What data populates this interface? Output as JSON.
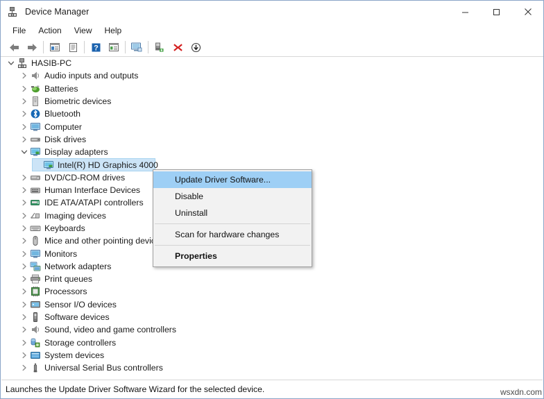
{
  "window": {
    "title": "Device Manager",
    "title_icon": "device-manager-icon",
    "minimize_label": "—",
    "maximize_label": "□",
    "close_label": "✕"
  },
  "menubar": {
    "items": [
      {
        "label": "File"
      },
      {
        "label": "Action"
      },
      {
        "label": "View"
      },
      {
        "label": "Help"
      }
    ]
  },
  "toolbar": {
    "buttons": [
      {
        "name": "back-icon",
        "title": "Back"
      },
      {
        "name": "forward-icon",
        "title": "Forward"
      },
      {
        "name": "separator-1",
        "title": ""
      },
      {
        "name": "properties-icon",
        "title": "Properties"
      },
      {
        "name": "show-hide-console-tree-icon",
        "title": "Show/Hide Console Tree"
      },
      {
        "name": "separator-2",
        "title": ""
      },
      {
        "name": "help-icon",
        "title": "Help"
      },
      {
        "name": "view-list-icon",
        "title": "View"
      },
      {
        "name": "separator-3",
        "title": ""
      },
      {
        "name": "scan-hardware-changes-icon",
        "title": "Scan for hardware changes"
      },
      {
        "name": "separator-4",
        "title": ""
      },
      {
        "name": "update-driver-icon",
        "title": "Update Driver Software"
      },
      {
        "name": "uninstall-device-icon",
        "title": "Uninstall"
      },
      {
        "name": "disable-device-icon",
        "title": "Disable"
      }
    ]
  },
  "tree": {
    "nodes": [
      {
        "label": "HASIB-PC",
        "level": 0,
        "twisty": "expanded",
        "icon": "computer-node-icon",
        "selected": false
      },
      {
        "label": "Audio inputs and outputs",
        "level": 1,
        "twisty": "collapsed",
        "icon": "speaker-icon",
        "selected": false
      },
      {
        "label": "Batteries",
        "level": 1,
        "twisty": "collapsed",
        "icon": "battery-icon",
        "selected": false
      },
      {
        "label": "Biometric devices",
        "level": 1,
        "twisty": "collapsed",
        "icon": "biometric-icon",
        "selected": false
      },
      {
        "label": "Bluetooth",
        "level": 1,
        "twisty": "collapsed",
        "icon": "bluetooth-icon",
        "selected": false
      },
      {
        "label": "Computer",
        "level": 1,
        "twisty": "collapsed",
        "icon": "monitor-icon",
        "selected": false
      },
      {
        "label": "Disk drives",
        "level": 1,
        "twisty": "collapsed",
        "icon": "disk-drive-icon",
        "selected": false
      },
      {
        "label": "Display adapters",
        "level": 1,
        "twisty": "expanded",
        "icon": "display-adapter-icon",
        "selected": false
      },
      {
        "label": "Intel(R) HD Graphics 4000",
        "level": 2,
        "twisty": "none",
        "icon": "display-adapter-icon",
        "selected": true
      },
      {
        "label": "DVD/CD-ROM drives",
        "level": 1,
        "twisty": "collapsed",
        "icon": "dvd-drive-icon",
        "selected": false
      },
      {
        "label": "Human Interface Devices",
        "level": 1,
        "twisty": "collapsed",
        "icon": "hid-icon",
        "selected": false
      },
      {
        "label": "IDE ATA/ATAPI controllers",
        "level": 1,
        "twisty": "collapsed",
        "icon": "ide-controller-icon",
        "selected": false
      },
      {
        "label": "Imaging devices",
        "level": 1,
        "twisty": "collapsed",
        "icon": "imaging-icon",
        "selected": false
      },
      {
        "label": "Keyboards",
        "level": 1,
        "twisty": "collapsed",
        "icon": "keyboard-icon",
        "selected": false
      },
      {
        "label": "Mice and other pointing devices",
        "level": 1,
        "twisty": "collapsed",
        "icon": "mouse-icon",
        "selected": false
      },
      {
        "label": "Monitors",
        "level": 1,
        "twisty": "collapsed",
        "icon": "monitor-icon",
        "selected": false
      },
      {
        "label": "Network adapters",
        "level": 1,
        "twisty": "collapsed",
        "icon": "network-adapter-icon",
        "selected": false
      },
      {
        "label": "Print queues",
        "level": 1,
        "twisty": "collapsed",
        "icon": "printer-icon",
        "selected": false
      },
      {
        "label": "Processors",
        "level": 1,
        "twisty": "collapsed",
        "icon": "processor-icon",
        "selected": false
      },
      {
        "label": "Sensor I/O devices",
        "level": 1,
        "twisty": "collapsed",
        "icon": "sensor-icon",
        "selected": false
      },
      {
        "label": "Software devices",
        "level": 1,
        "twisty": "collapsed",
        "icon": "software-device-icon",
        "selected": false
      },
      {
        "label": "Sound, video and game controllers",
        "level": 1,
        "twisty": "collapsed",
        "icon": "speaker-icon",
        "selected": false
      },
      {
        "label": "Storage controllers",
        "level": 1,
        "twisty": "collapsed",
        "icon": "storage-controller-icon",
        "selected": false
      },
      {
        "label": "System devices",
        "level": 1,
        "twisty": "collapsed",
        "icon": "system-device-icon",
        "selected": false
      },
      {
        "label": "Universal Serial Bus controllers",
        "level": 1,
        "twisty": "collapsed",
        "icon": "usb-icon",
        "selected": false
      }
    ]
  },
  "context_menu": {
    "items": [
      {
        "label": "Update Driver Software...",
        "highlight": true,
        "bold": false,
        "separator_after": false
      },
      {
        "label": "Disable",
        "highlight": false,
        "bold": false,
        "separator_after": false
      },
      {
        "label": "Uninstall",
        "highlight": false,
        "bold": false,
        "separator_after": true
      },
      {
        "label": "Scan for hardware changes",
        "highlight": false,
        "bold": false,
        "separator_after": true
      },
      {
        "label": "Properties",
        "highlight": false,
        "bold": true,
        "separator_after": false
      }
    ]
  },
  "statusbar": {
    "text": "Launches the Update Driver Software Wizard for the selected device."
  },
  "watermark": {
    "text": "wsxdn.com"
  },
  "colors": {
    "selection_fill": "#cce4f7",
    "selection_border": "#a8d4f0",
    "menu_highlight": "#9ecff5",
    "menu_background": "#f2f2f2",
    "window_border": "#8aa4c8"
  }
}
